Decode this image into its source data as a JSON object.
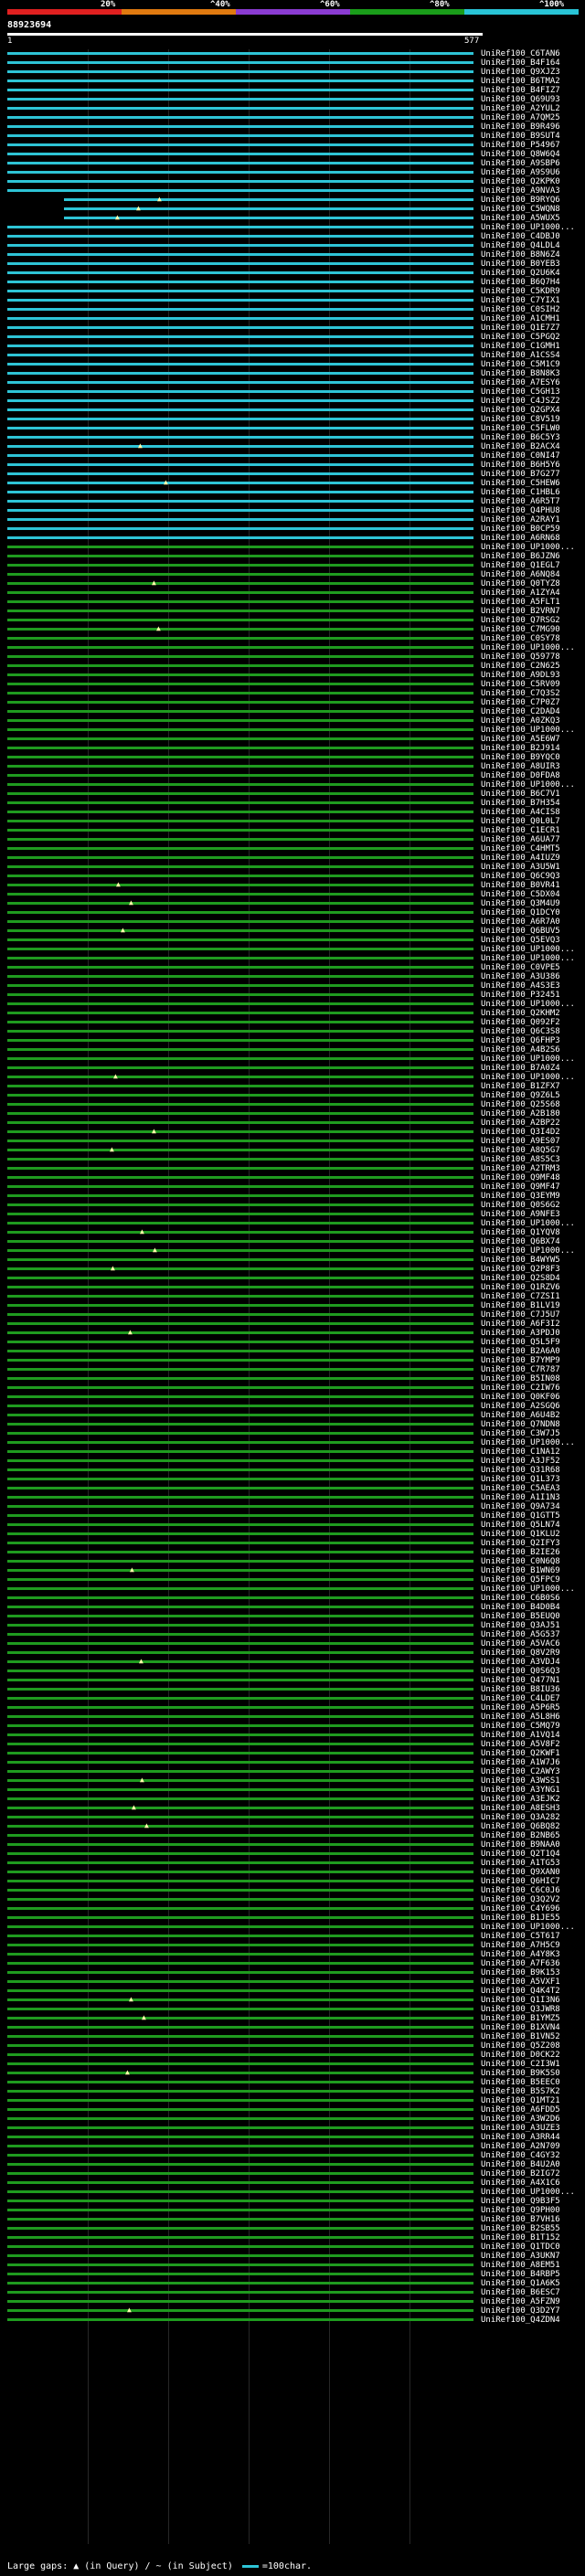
{
  "legend": {
    "ticks": [
      "20%",
      "^40%",
      "^60%",
      "^80%",
      "^100%"
    ],
    "colors": [
      "#e02020",
      "#e07a10",
      "#8a3bd1",
      "#1a9d1a",
      "#29c4d6"
    ]
  },
  "query_id": "88923694",
  "query_range": {
    "start": "1",
    "end": "577"
  },
  "footer": {
    "gaps": "Large gaps: ▲ (in Query) / ~ (in Subject)",
    "scale": "=100char."
  },
  "hits": [
    "UniRef100_C6TAN6",
    "UniRef100_B4F164",
    "UniRef100_Q9XJZ3",
    "UniRef100_B6TMA2",
    "UniRef100_B4FIZ7",
    "UniRef100_Q69U93",
    "UniRef100_A2YUL2",
    "UniRef100_A7QM25",
    "UniRef100_B9R496",
    "UniRef100_B9SUT4",
    "UniRef100_P54967",
    "UniRef100_Q8W6Q4",
    "UniRef100_A9SBP6",
    "UniRef100_A9S9U6",
    "UniRef100_Q2KPK0",
    "UniRef100_A9NVA3",
    "UniRef100_B9RYQ6",
    "UniRef100_C5WQN8",
    "UniRef100_A5WUX5",
    "UniRef100_UP1000...",
    "UniRef100_C4DBJ0",
    "UniRef100_Q4LDL4",
    "UniRef100_B8N6Z4",
    "UniRef100_B0YEB3",
    "UniRef100_Q2U6K4",
    "UniRef100_B6Q7H4",
    "UniRef100_C5KDR9",
    "UniRef100_C7YIX1",
    "UniRef100_C0SIH2",
    "UniRef100_A1CMH1",
    "UniRef100_Q1E7Z7",
    "UniRef100_C5PGQ2",
    "UniRef100_C1GMH1",
    "UniRef100_A1CSS4",
    "UniRef100_C5M1C9",
    "UniRef100_B8N8K3",
    "UniRef100_A7ESY6",
    "UniRef100_C5GH13",
    "UniRef100_C4JSZ2",
    "UniRef100_Q2GPX4",
    "UniRef100_C8V519",
    "UniRef100_C5FLW0",
    "UniRef100_B6C5Y3",
    "UniRef100_B2ACX4",
    "UniRef100_C0NI47",
    "UniRef100_B6H5Y6",
    "UniRef100_B7G277",
    "UniRef100_C5HEW6",
    "UniRef100_C1HBL6",
    "UniRef100_A6R5T7",
    "UniRef100_Q4PHU8",
    "UniRef100_A2RAY1",
    "UniRef100_B0CP59",
    "UniRef100_A6RN68",
    "UniRef100_UP1000...",
    "UniRef100_B6JZN6",
    "UniRef100_Q1EGL7",
    "UniRef100_A6NQ84",
    "UniRef100_Q0TYZ8",
    "UniRef100_A1ZYA4",
    "UniRef100_A5FLT1",
    "UniRef100_B2VRN7",
    "UniRef100_Q7RSG2",
    "UniRef100_C7MG90",
    "UniRef100_C0SY78",
    "UniRef100_UP1000...",
    "UniRef100_Q59778",
    "UniRef100_C2N625",
    "UniRef100_A9DL93",
    "UniRef100_C5RV09",
    "UniRef100_C7Q3S2",
    "UniRef100_C7P0Z7",
    "UniRef100_C2DAD4",
    "UniRef100_A0ZKQ3",
    "UniRef100_UP1000...",
    "UniRef100_A5E6W7",
    "UniRef100_B2J914",
    "UniRef100_B9YQC0",
    "UniRef100_A8UIR3",
    "UniRef100_D0FDA8",
    "UniRef100_UP1000...",
    "UniRef100_B6C7V1",
    "UniRef100_B7H354",
    "UniRef100_A4CIS8",
    "UniRef100_Q0L0L7",
    "UniRef100_C1ECR1",
    "UniRef100_A6UA77",
    "UniRef100_C4HMT5",
    "UniRef100_A4IUZ9",
    "UniRef100_A3U5W1",
    "UniRef100_Q6C9Q3",
    "UniRef100_B0VR41",
    "UniRef100_C5DX04",
    "UniRef100_Q3M4U9",
    "UniRef100_Q1DCY0",
    "UniRef100_A6R7A0",
    "UniRef100_Q6BUV5",
    "UniRef100_Q5EVQ3",
    "UniRef100_UP1000...",
    "UniRef100_UP1000...",
    "UniRef100_C0VPE5",
    "UniRef100_A3U386",
    "UniRef100_A4S3E3",
    "UniRef100_P32451",
    "UniRef100_UP1000...",
    "UniRef100_Q2KHM2",
    "UniRef100_Q092F2",
    "UniRef100_Q6C3S8",
    "UniRef100_Q6FHP3",
    "UniRef100_A4B2S6",
    "UniRef100_UP1000...",
    "UniRef100_B7A0Z4",
    "UniRef100_UP1000...",
    "UniRef100_B1ZFX7",
    "UniRef100_Q9Z6L5",
    "UniRef100_Q25S68",
    "UniRef100_A2B180",
    "UniRef100_A2BP22",
    "UniRef100_Q3I4D2",
    "UniRef100_A9ES07",
    "UniRef100_A8Q5G7",
    "UniRef100_A8S5C3",
    "UniRef100_A2TRM3",
    "UniRef100_Q9MF48",
    "UniRef100_Q9MF47",
    "UniRef100_Q3EYM9",
    "UniRef100_Q0S6G2",
    "UniRef100_A9NFE3",
    "UniRef100_UP1000...",
    "UniRef100_Q1YQV8",
    "UniRef100_Q6BX74",
    "UniRef100_UP1000...",
    "UniRef100_B4WYW5",
    "UniRef100_Q2P8F3",
    "UniRef100_Q2S8D4",
    "UniRef100_Q1RZV6",
    "UniRef100_C7ZSI1",
    "UniRef100_B1LV19",
    "UniRef100_C7J5U7",
    "UniRef100_A6F3I2",
    "UniRef100_A3PDJ0",
    "UniRef100_Q5L5F9",
    "UniRef100_B2A6A0",
    "UniRef100_B7YMP9",
    "UniRef100_C7R787",
    "UniRef100_B5IN08",
    "UniRef100_C2IW76",
    "UniRef100_Q0KF06",
    "UniRef100_A2SGQ6",
    "UniRef100_A6U4B2",
    "UniRef100_Q7NDN8",
    "UniRef100_C3W7J5",
    "UniRef100_UP1000...",
    "UniRef100_C1NA12",
    "UniRef100_A3JF52",
    "UniRef100_Q31R68",
    "UniRef100_Q1L373",
    "UniRef100_C5AEA3",
    "UniRef100_A1I1N3",
    "UniRef100_Q9A734",
    "UniRef100_Q1GTT5",
    "UniRef100_Q5LN74",
    "UniRef100_Q1KLU2",
    "UniRef100_Q2IFY3",
    "UniRef100_B2IE26",
    "UniRef100_C0N6Q8",
    "UniRef100_B1WN69",
    "UniRef100_Q5FPC9",
    "UniRef100_UP1000...",
    "UniRef100_C6B0S6",
    "UniRef100_B4D0B4",
    "UniRef100_B5EUQ0",
    "UniRef100_Q3AJ51",
    "UniRef100_A5G537",
    "UniRef100_A5VAC6",
    "UniRef100_Q8V2R9",
    "UniRef100_A3VDJ4",
    "UniRef100_Q0S6Q3",
    "UniRef100_Q477N1",
    "UniRef100_B8IU36",
    "UniRef100_C4LDE7",
    "UniRef100_A5P6R5",
    "UniRef100_A5L8H6",
    "UniRef100_C5MQ79",
    "UniRef100_A1VQ14",
    "UniRef100_A5V8F2",
    "UniRef100_Q2KWF1",
    "UniRef100_A1W7J6",
    "UniRef100_C2AWY3",
    "UniRef100_A3WSS1",
    "UniRef100_A3YNG1",
    "UniRef100_A3EJK2",
    "UniRef100_A8ESH3",
    "UniRef100_Q3A282",
    "UniRef100_Q6BQ82",
    "UniRef100_B2NB65",
    "UniRef100_B9NAA0",
    "UniRef100_Q2T1Q4",
    "UniRef100_A1TG53",
    "UniRef100_Q9XAN0",
    "UniRef100_Q6HIC7",
    "UniRef100_C6C0J6",
    "UniRef100_Q3Q2V2",
    "UniRef100_C4Y696",
    "UniRef100_B1JE55",
    "UniRef100_UP1000...",
    "UniRef100_C5T617",
    "UniRef100_A7H5C9",
    "UniRef100_A4Y8K3",
    "UniRef100_A7F636",
    "UniRef100_B9K153",
    "UniRef100_A5VXF1",
    "UniRef100_Q4K4T2",
    "UniRef100_Q1I3N6",
    "UniRef100_Q3JWR8",
    "UniRef100_B1YMZ5",
    "UniRef100_B1XVN4",
    "UniRef100_B1VN52",
    "UniRef100_Q5Z208",
    "UniRef100_D0CK22",
    "UniRef100_C2I3W1",
    "UniRef100_B9K5S0",
    "UniRef100_B5EEC0",
    "UniRef100_B5S7K2",
    "UniRef100_Q1MT21",
    "UniRef100_A6FDD5",
    "UniRef100_A3W2D6",
    "UniRef100_A3UZE3",
    "UniRef100_A3RR44",
    "UniRef100_A2N709",
    "UniRef100_C4GY32",
    "UniRef100_B4U2A0",
    "UniRef100_B2IG72",
    "UniRef100_A4X1C6",
    "UniRef100_UP1000...",
    "UniRef100_Q9B3F5",
    "UniRef100_Q9PH00",
    "UniRef100_B7VH16",
    "UniRef100_B2SB55",
    "UniRef100_B1T152",
    "UniRef100_Q1TDC0",
    "UniRef100_A3UKN7",
    "UniRef100_A8EM51",
    "UniRef100_B4RBP5",
    "UniRef100_Q1A6K5",
    "UniRef100_B6ESC7",
    "UniRef100_A5FZN9",
    "UniRef100_Q3D2Y7",
    "UniRef100_Q4ZDN4"
  ]
}
